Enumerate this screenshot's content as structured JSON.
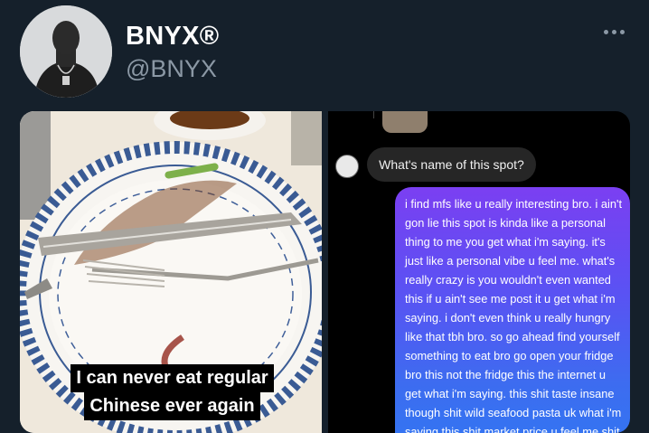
{
  "profile": {
    "display_name": "BNYX®",
    "handle": "@BNYX",
    "more_icon": "more-horizontal-icon"
  },
  "media": {
    "photo": {
      "description_icon": "plate-icon",
      "caption_line1": "I can never eat regular",
      "caption_line2": "Chinese ever again"
    },
    "dm": {
      "received_message": "What's name of this spot?",
      "sent_message": "i find mfs like u really interesting bro. i ain't gon lie this spot is kinda like a personal thing to me you get what i'm saying. it's just like a personal vibe u feel me. what's really crazy is you wouldn't even wanted this if u ain't see me post it u get what i'm saying. i don't even think u really hungry like that tbh bro. so go ahead find yourself something to eat bro go open your fridge bro this not the fridge this the internet u get what i'm saying. this shit taste insane though shit wild seafood pasta uk what i'm saying this shit market price u feel me shit i wish i"
    }
  },
  "colors": {
    "background": "#15202b",
    "name": "#ffffff",
    "handle": "#8b98a5",
    "bubble_received": "#262626",
    "bubble_sent_top": "#7b3ff2",
    "bubble_sent_bottom": "#3276f2"
  }
}
